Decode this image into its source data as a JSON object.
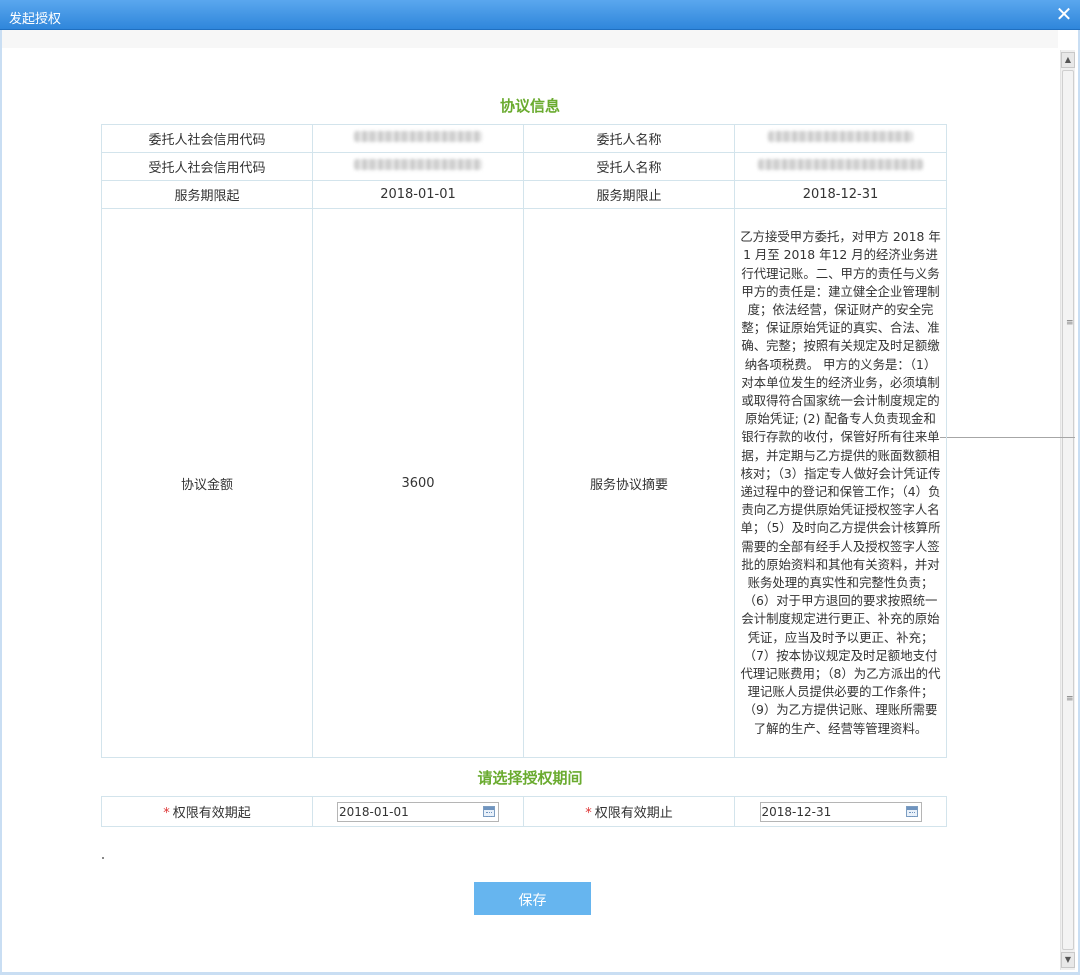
{
  "window": {
    "title": "发起授权",
    "close_label": "✕"
  },
  "agreement": {
    "section_title": "协议信息",
    "rows": {
      "principal_credit_code_label": "委托人社会信用代码",
      "principal_name_label": "委托人名称",
      "agent_credit_code_label": "受托人社会信用代码",
      "agent_name_label": "受托人名称",
      "service_start_label": "服务期限起",
      "service_start_value": "2018-01-01",
      "service_end_label": "服务期限止",
      "service_end_value": "2018-12-31",
      "amount_label": "协议金额",
      "amount_value": "3600",
      "summary_label": "服务协议摘要",
      "summary_value": "乙方接受甲方委托，对甲方 2018 年 1 月至 2018 年12 月的经济业务进行代理记账。二、甲方的责任与义务 甲方的责任是：建立健全企业管理制度；依法经营，保证财产的安全完整；保证原始凭证的真实、合法、准确、完整；按照有关规定及时足额缴纳各项税费。 甲方的义务是：（1）对本单位发生的经济业务，必须填制或取得符合国家统一会计制度规定的原始凭证; (2) 配备专人负责现金和银行存款的收付，保管好所有往来单据，并定期与乙方提供的账面数额相核对；（3）指定专人做好会计凭证传递过程中的登记和保管工作；（4）负责向乙方提供原始凭证授权签字人名单；（5）及时向乙方提供会计核算所需要的全部有经手人及授权签字人签批的原始资料和其他有关资料，并对账务处理的真实性和完整性负责；（6）对于甲方退回的要求按照统一会计制度规定进行更正、补充的原始凭证，应当及时予以更正、补充；（7）按本协议规定及时足额地支付代理记账费用；（8）为乙方派出的代理记账人员提供必要的工作条件；（9）为乙方提供记账、理账所需要了解的生产、经营等管理资料。"
    }
  },
  "authorization": {
    "section_title": "请选择授权期间",
    "required_mark": "*",
    "start_label": "权限有效期起",
    "start_value": "2018-01-01",
    "end_label": "权限有效期止",
    "end_value": "2018-12-31"
  },
  "actions": {
    "save_label": "保存"
  },
  "colors": {
    "accent_green": "#6aab2f",
    "title_bar": "#2f86db",
    "button": "#66b5ef"
  }
}
